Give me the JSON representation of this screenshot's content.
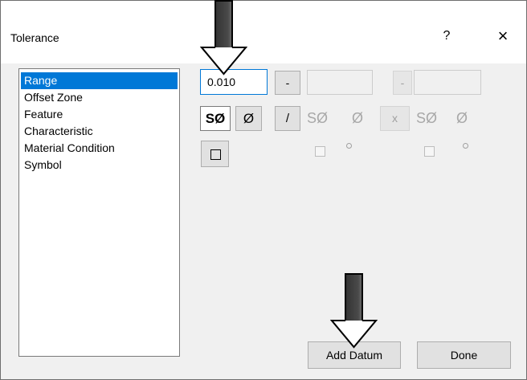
{
  "window": {
    "title": "Tolerance",
    "help_glyph": "?",
    "close_glyph": "×"
  },
  "list": {
    "items": [
      "Range",
      "Offset Zone",
      "Feature",
      "Characteristic",
      "Material Condition",
      "Symbol"
    ],
    "selected": "Range"
  },
  "range_row": {
    "value": "0.010",
    "minus_label": "-",
    "minus2_label": "-"
  },
  "symbol_row": {
    "sphere_dia": "SØ",
    "dia": "Ø",
    "slash": "/",
    "sphere_dia_2": "SØ",
    "dia_2": "Ø",
    "x_label": "x",
    "sphere_dia_3": "SØ",
    "dia_3": "Ø"
  },
  "buttons": {
    "add_datum": "Add Datum",
    "done": "Done"
  },
  "colors": {
    "selection": "#0078d7",
    "dialog_bg": "#f0f0f0",
    "arrow": "#000000"
  },
  "icons": [
    "down-arrow-icon",
    "down-arrow-icon",
    "square-icon"
  ]
}
